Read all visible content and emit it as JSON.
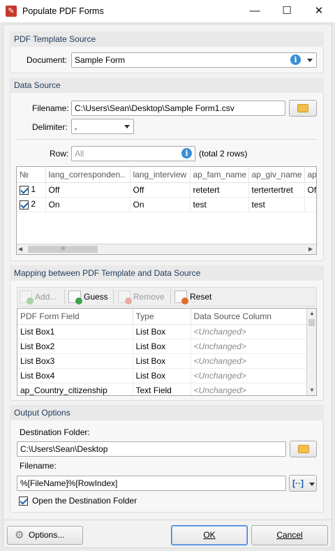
{
  "window": {
    "title": "Populate PDF Forms",
    "minimize": "—",
    "maximize": "☐",
    "close": "✕"
  },
  "template_source": {
    "heading": "PDF Template Source",
    "document_label": "Document:",
    "document_value": "Sample Form"
  },
  "data_source": {
    "heading": "Data Source",
    "filename_label": "Filename:",
    "filename_value": "C:\\Users\\Sean\\Desktop\\Sample Form1.csv",
    "delimiter_label": "Delimiter:",
    "delimiter_value": ",",
    "row_label": "Row:",
    "row_placeholder": "All",
    "row_total": "(total 2 rows)",
    "columns": [
      "№",
      "lang_corresponden..",
      "lang_interview",
      "ap_fam_name",
      "ap_giv_name",
      "ap"
    ],
    "rows": [
      {
        "num": "1",
        "c1": "Off",
        "c2": "Off",
        "c3": "retetert",
        "c4": "tertertertret",
        "c5": "Off"
      },
      {
        "num": "2",
        "c1": "On",
        "c2": "On",
        "c3": "test",
        "c4": "test",
        "c5": ""
      }
    ],
    "scroll_grip": "III"
  },
  "mapping": {
    "heading": "Mapping between PDF Template and Data Source",
    "add_label": "Add...",
    "guess_label": "Guess",
    "remove_label": "Remove",
    "reset_label": "Reset",
    "columns": [
      "PDF Form Field",
      "Type",
      "Data Source Column"
    ],
    "rows": [
      {
        "field": "List Box1",
        "type": "List Box",
        "column": "<Unchanged>"
      },
      {
        "field": "List Box2",
        "type": "List Box",
        "column": "<Unchanged>"
      },
      {
        "field": "List Box3",
        "type": "List Box",
        "column": "<Unchanged>"
      },
      {
        "field": "List Box4",
        "type": "List Box",
        "column": "<Unchanged>"
      },
      {
        "field": "ap_Country_citizenship",
        "type": "Text Field",
        "column": "<Unchanged>"
      }
    ]
  },
  "output": {
    "heading": "Output Options",
    "dest_label": "Destination Folder:",
    "dest_value": "C:\\Users\\Sean\\Desktop",
    "filename_label": "Filename:",
    "filename_value": "%[FileName]%[RowIndex]",
    "open_folder_label": "Open the Destination Folder",
    "macro_glyph": "[··]"
  },
  "footer": {
    "options_label": "Options...",
    "ok_label": "OK",
    "cancel_label": "Cancel"
  },
  "colors": {
    "accent": "#1a5fb4",
    "heading": "#1f3a5c",
    "info": "#3a8fd6"
  }
}
